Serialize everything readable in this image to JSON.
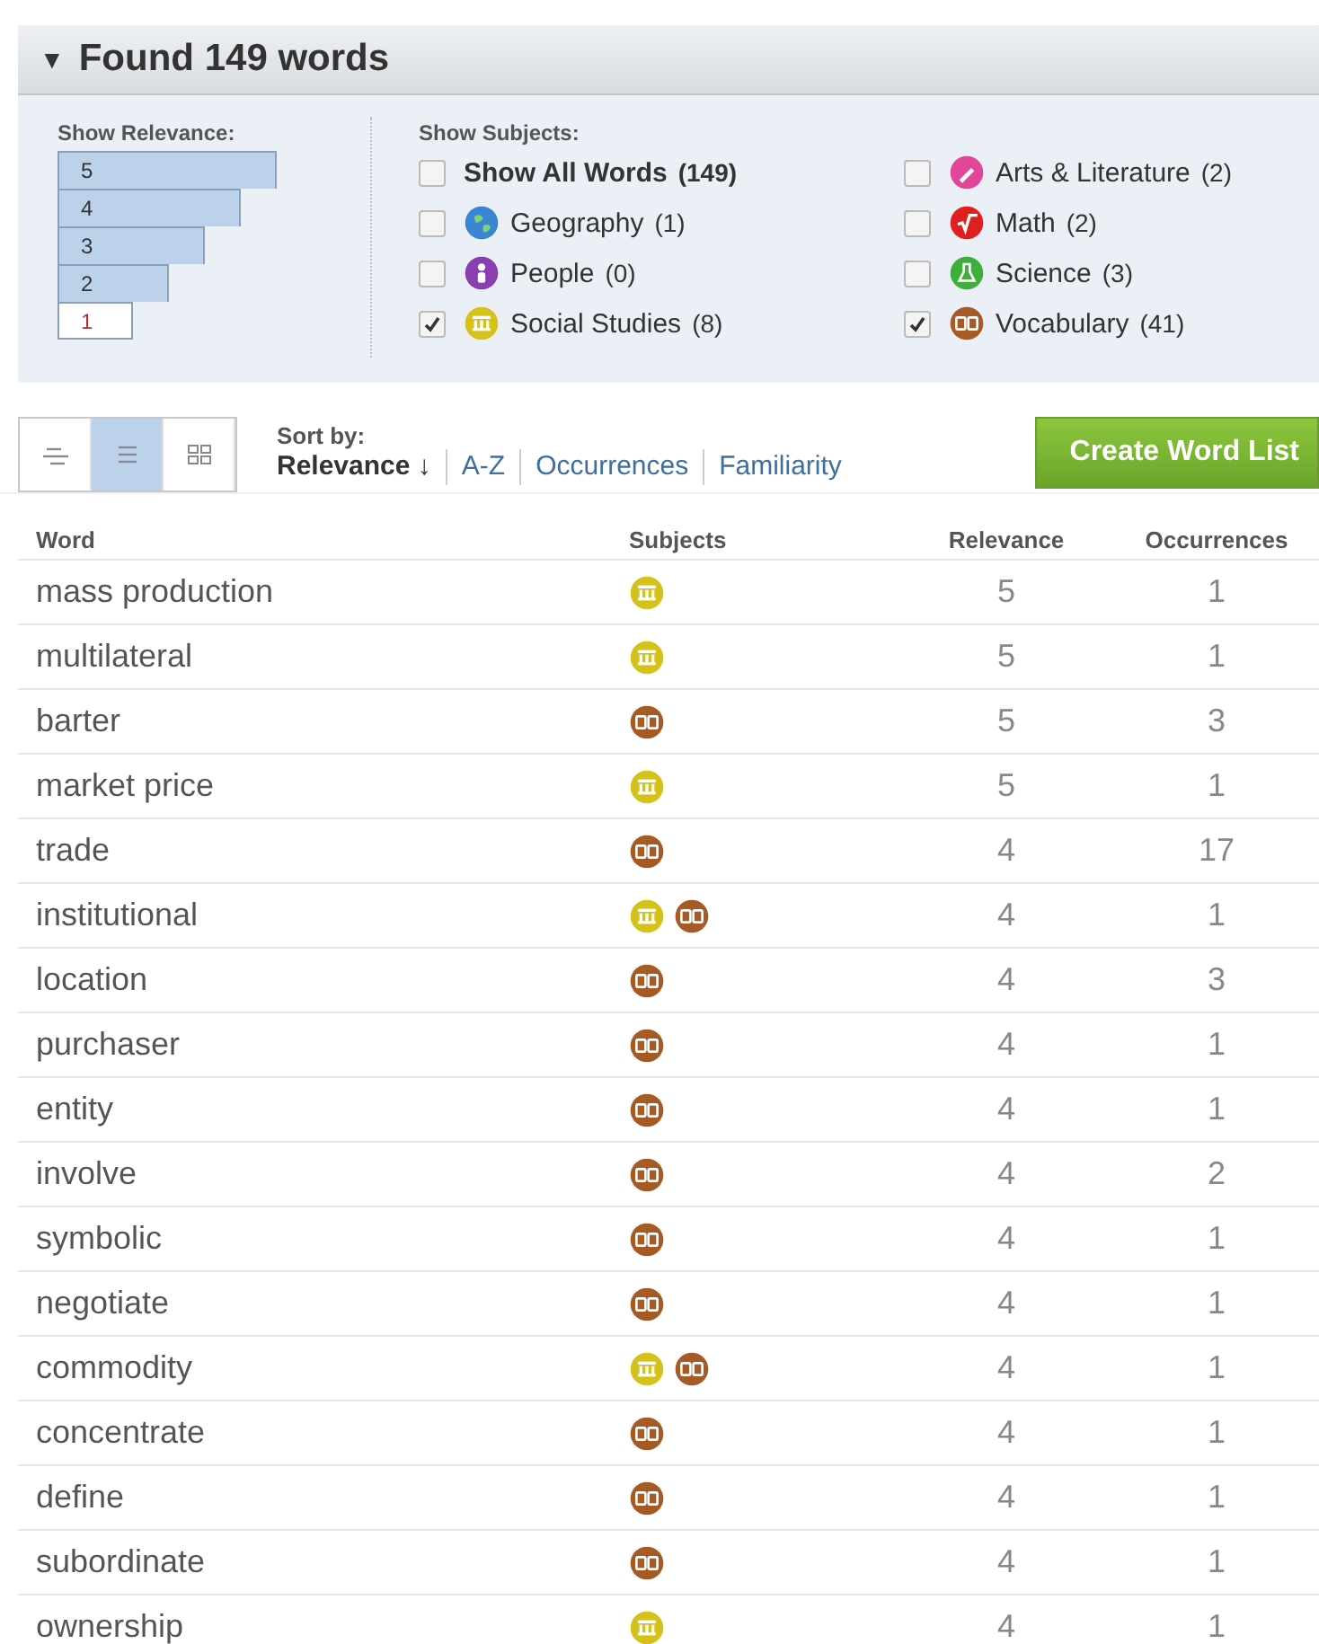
{
  "header": {
    "arrow": "▼",
    "title": "Found 149 words"
  },
  "relevance_filter": {
    "label": "Show Relevance:",
    "levels": [
      {
        "label": "5",
        "selected": true
      },
      {
        "label": "4",
        "selected": true
      },
      {
        "label": "3",
        "selected": true
      },
      {
        "label": "2",
        "selected": true
      },
      {
        "label": "1",
        "selected": false
      }
    ]
  },
  "subject_filter": {
    "label": "Show Subjects:",
    "items": [
      {
        "kind": "all",
        "label": "Show All Words",
        "count": "(149)",
        "checked": false
      },
      {
        "kind": "arts",
        "label": "Arts & Literature",
        "count": "(2)",
        "checked": false
      },
      {
        "kind": "geography",
        "label": "Geography",
        "count": "(1)",
        "checked": false
      },
      {
        "kind": "math",
        "label": "Math",
        "count": "(2)",
        "checked": false
      },
      {
        "kind": "people",
        "label": "People",
        "count": "(0)",
        "checked": false
      },
      {
        "kind": "science",
        "label": "Science",
        "count": "(3)",
        "checked": false
      },
      {
        "kind": "social",
        "label": "Social Studies",
        "count": "(8)",
        "checked": true
      },
      {
        "kind": "vocabulary",
        "label": "Vocabulary",
        "count": "(41)",
        "checked": true
      }
    ]
  },
  "view_modes": [
    {
      "kind": "compact",
      "selected": false
    },
    {
      "kind": "list",
      "selected": true
    },
    {
      "kind": "grid",
      "selected": false
    }
  ],
  "sort": {
    "label": "Sort by:",
    "options": [
      {
        "label": "Relevance",
        "arrow": "↓",
        "selected": true
      },
      {
        "label": "A-Z",
        "selected": false
      },
      {
        "label": "Occurrences",
        "selected": false
      },
      {
        "label": "Familiarity",
        "selected": false
      }
    ]
  },
  "create_button": "Create Word List",
  "table": {
    "columns": [
      "Word",
      "Subjects",
      "Relevance",
      "Occurrences"
    ],
    "rows": [
      {
        "word": "mass production",
        "subjects": [
          {
            "kind": "social"
          }
        ],
        "relevance": "5",
        "occurrences": "1"
      },
      {
        "word": "multilateral",
        "subjects": [
          {
            "kind": "social"
          }
        ],
        "relevance": "5",
        "occurrences": "1"
      },
      {
        "word": "barter",
        "subjects": [
          {
            "kind": "vocabulary"
          }
        ],
        "relevance": "5",
        "occurrences": "3"
      },
      {
        "word": "market price",
        "subjects": [
          {
            "kind": "social"
          }
        ],
        "relevance": "5",
        "occurrences": "1"
      },
      {
        "word": "trade",
        "subjects": [
          {
            "kind": "vocabulary"
          }
        ],
        "relevance": "4",
        "occurrences": "17"
      },
      {
        "word": "institutional",
        "subjects": [
          {
            "kind": "social"
          },
          {
            "kind": "vocabulary"
          }
        ],
        "relevance": "4",
        "occurrences": "1"
      },
      {
        "word": "location",
        "subjects": [
          {
            "kind": "vocabulary"
          }
        ],
        "relevance": "4",
        "occurrences": "3"
      },
      {
        "word": "purchaser",
        "subjects": [
          {
            "kind": "vocabulary"
          }
        ],
        "relevance": "4",
        "occurrences": "1"
      },
      {
        "word": "entity",
        "subjects": [
          {
            "kind": "vocabulary"
          }
        ],
        "relevance": "4",
        "occurrences": "1"
      },
      {
        "word": "involve",
        "subjects": [
          {
            "kind": "vocabulary"
          }
        ],
        "relevance": "4",
        "occurrences": "2"
      },
      {
        "word": "symbolic",
        "subjects": [
          {
            "kind": "vocabulary"
          }
        ],
        "relevance": "4",
        "occurrences": "1"
      },
      {
        "word": "negotiate",
        "subjects": [
          {
            "kind": "vocabulary"
          }
        ],
        "relevance": "4",
        "occurrences": "1"
      },
      {
        "word": "commodity",
        "subjects": [
          {
            "kind": "social"
          },
          {
            "kind": "vocabulary"
          }
        ],
        "relevance": "4",
        "occurrences": "1"
      },
      {
        "word": "concentrate",
        "subjects": [
          {
            "kind": "vocabulary"
          }
        ],
        "relevance": "4",
        "occurrences": "1"
      },
      {
        "word": "define",
        "subjects": [
          {
            "kind": "vocabulary"
          }
        ],
        "relevance": "4",
        "occurrences": "1"
      },
      {
        "word": "subordinate",
        "subjects": [
          {
            "kind": "vocabulary"
          }
        ],
        "relevance": "4",
        "occurrences": "1"
      },
      {
        "word": "ownership",
        "subjects": [
          {
            "kind": "social"
          }
        ],
        "relevance": "4",
        "occurrences": "1"
      }
    ]
  }
}
